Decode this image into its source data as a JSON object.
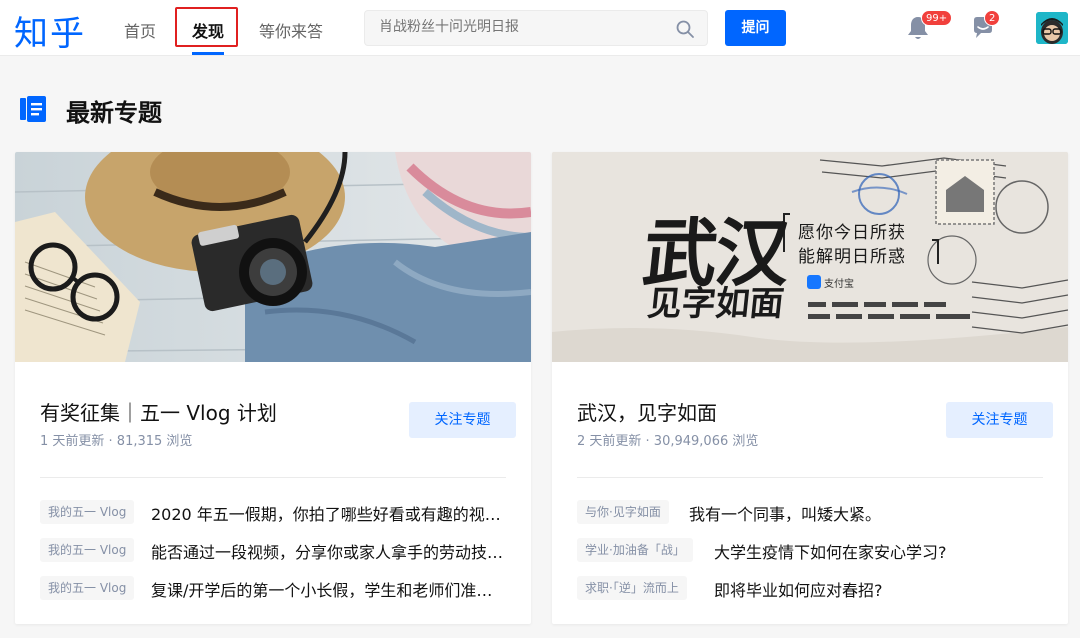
{
  "header": {
    "logo": "知乎",
    "tabs": [
      {
        "label": "首页"
      },
      {
        "label": "发现"
      },
      {
        "label": "等你来答"
      }
    ],
    "search": {
      "placeholder": "肖战粉丝十问光明日报"
    },
    "ask_label": "提问",
    "notifications_badge": "99+",
    "messages_badge": "2"
  },
  "section": {
    "title": "最新专题"
  },
  "cards": [
    {
      "title": "有奖征集｜五一 Vlog 计划",
      "meta": "1 天前更新 · 81,315 浏览",
      "follow_label": "关注专题",
      "questions": [
        {
          "tag": "我的五一 Vlog",
          "text": "2020 年五一假期，你拍了哪些好看或有趣的视…"
        },
        {
          "tag": "我的五一 Vlog",
          "text": "能否通过一段视频，分享你或家人拿手的劳动技…"
        },
        {
          "tag": "我的五一 Vlog",
          "text": "复课/开学后的第一个小长假，学生和老师们准…"
        }
      ]
    },
    {
      "title": "武汉，见字如面",
      "meta": "2 天前更新 · 30,949,066 浏览",
      "follow_label": "关注专题",
      "cover_text": {
        "big1": "武汉",
        "big2": "见字如面",
        "quote_line1": "愿你今日所获",
        "quote_line2": "能解明日所惑",
        "alipay": "支付宝"
      },
      "questions": [
        {
          "tag": "与你·见字如面",
          "text": "我有一个同事，叫矮大紧。"
        },
        {
          "tag": "学业·加油备「战」",
          "text": "大学生疫情下如何在家安心学习?"
        },
        {
          "tag": "求职·「逆」流而上",
          "text": "即将毕业如何应对春招?"
        }
      ]
    }
  ],
  "colors": {
    "brand": "#0066ff",
    "badge": "#f1403c",
    "highlight": "#e02020"
  }
}
